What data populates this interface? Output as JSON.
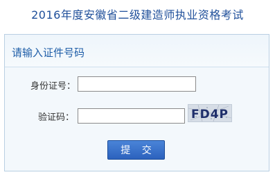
{
  "header": {
    "title": "2016年度安徽省二级建造师执业资格考试"
  },
  "form": {
    "heading": "请输入证件号码",
    "id_label": "身份证号：",
    "id_value": "",
    "captcha_label": "验证码：",
    "captcha_value": "",
    "captcha_text": "FD4P",
    "submit_label": "提 交"
  }
}
